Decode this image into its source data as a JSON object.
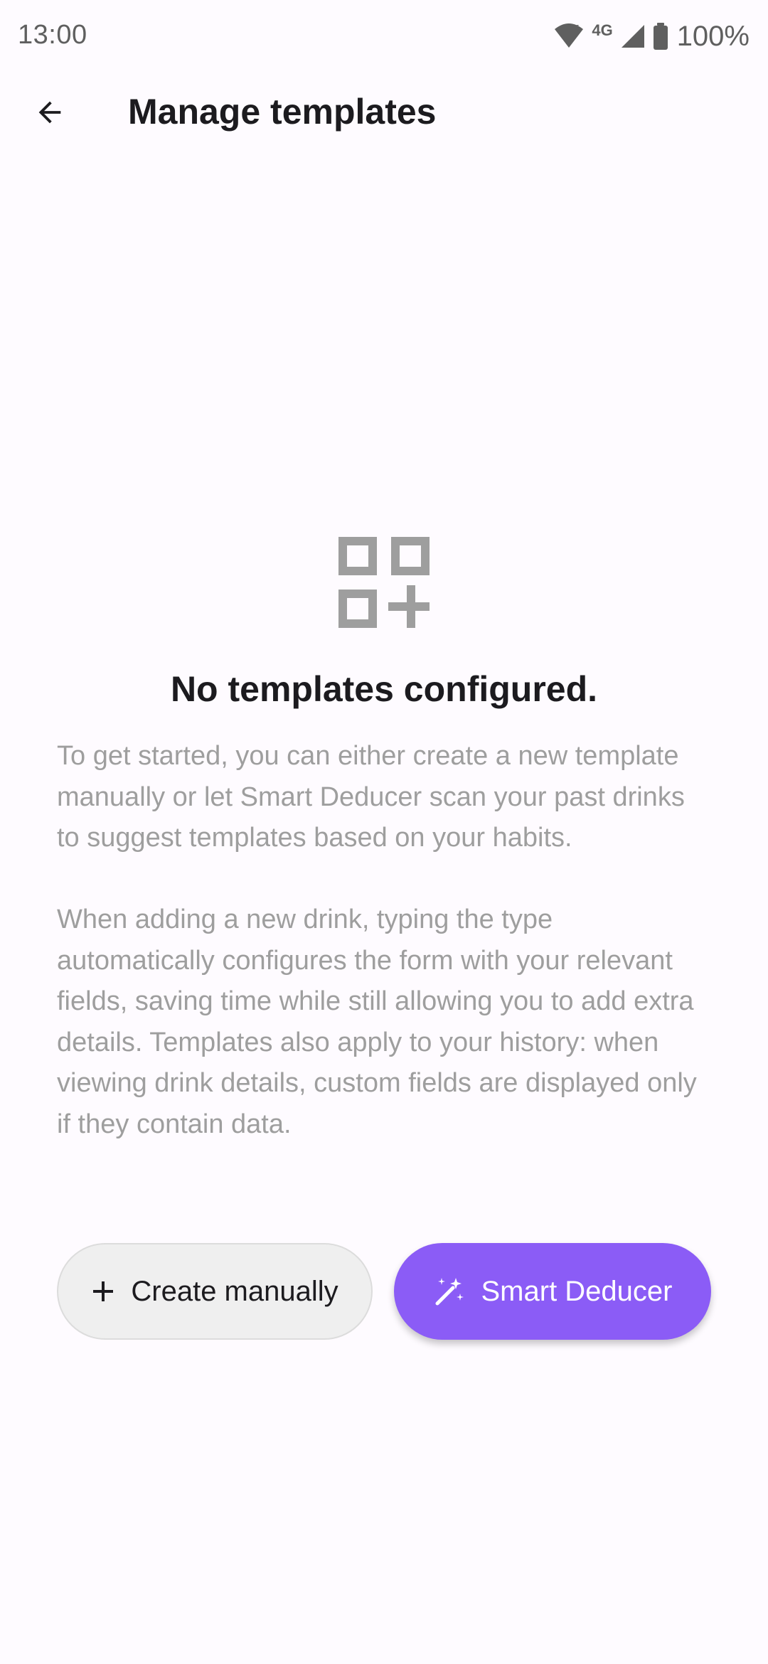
{
  "status_bar": {
    "time": "13:00",
    "network": "4G",
    "battery": "100%",
    "icons": [
      "wifi-icon",
      "cellular-signal-icon",
      "battery-icon"
    ]
  },
  "app_bar": {
    "title": "Manage templates",
    "back_icon": "arrow-back-icon"
  },
  "empty_state": {
    "icon": "grid-add-icon",
    "title": "No templates configured.",
    "paragraphs": [
      "To get started, you can either create a new template manually or let Smart Deducer scan your past drinks to suggest templates based on your habits.",
      "When adding a new drink, typing the type automatically configures the form with your relevant fields, saving time while still allowing you to add extra details. Templates also apply to your history: when viewing drink details, custom fields are displayed only if they contain data."
    ]
  },
  "actions": {
    "create_manually": {
      "label": "Create manually",
      "icon": "plus-icon"
    },
    "smart_deducer": {
      "label": "Smart Deducer",
      "icon": "magic-wand-icon"
    }
  },
  "colors": {
    "background": "#fefbff",
    "accent": "#8b5cf6",
    "secondary_button": "#efefef",
    "muted_text": "#9e9e9e",
    "icon_gray": "#9e9e9e"
  }
}
